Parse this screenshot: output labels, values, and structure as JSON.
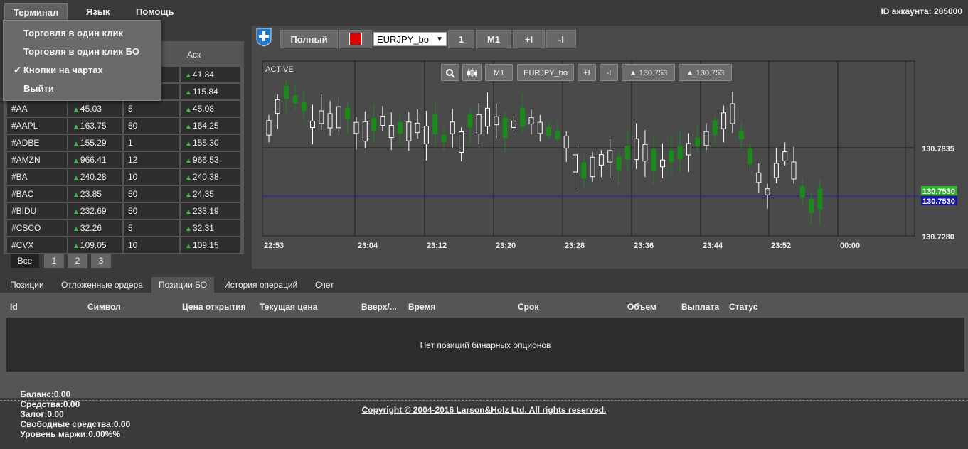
{
  "menu": {
    "terminal": "Терминал",
    "language": "Язык",
    "help": "Помощь"
  },
  "account": {
    "label": "ID аккаунта: 285000"
  },
  "dropdown": {
    "items": [
      "Торговля в один клик",
      "Торговля в один клик БО",
      "Кнопки на чартах",
      "Выйти"
    ],
    "checked_index": 2
  },
  "quotes": {
    "ask_header": "Аск",
    "partial_rows": [
      {
        "ask": "41.84"
      },
      {
        "ask": "115.84"
      }
    ],
    "rows": [
      {
        "symbol": "#AA",
        "bid": "45.03",
        "spread": "5",
        "ask": "45.08"
      },
      {
        "symbol": "#AAPL",
        "bid": "163.75",
        "spread": "50",
        "ask": "164.25"
      },
      {
        "symbol": "#ADBE",
        "bid": "155.29",
        "spread": "1",
        "ask": "155.30"
      },
      {
        "symbol": "#AMZN",
        "bid": "966.41",
        "spread": "12",
        "ask": "966.53"
      },
      {
        "symbol": "#BA",
        "bid": "240.28",
        "spread": "10",
        "ask": "240.38"
      },
      {
        "symbol": "#BAC",
        "bid": "23.85",
        "spread": "50",
        "ask": "24.35"
      },
      {
        "symbol": "#BIDU",
        "bid": "232.69",
        "spread": "50",
        "ask": "233.19"
      },
      {
        "symbol": "#CSCO",
        "bid": "32.26",
        "spread": "5",
        "ask": "32.31"
      },
      {
        "symbol": "#CVX",
        "bid": "109.05",
        "spread": "10",
        "ask": "109.15"
      }
    ],
    "pager": [
      "Все",
      "1",
      "2",
      "3"
    ]
  },
  "chart_toolbar": {
    "full": "Полный",
    "symbol": "EURJPY_bo",
    "qty": "1",
    "timeframe": "M1",
    "plus": "+I",
    "minus": "-I"
  },
  "chart": {
    "status": "ACTIVE",
    "inchart_buttons": [
      "M1",
      "EURJPY_bo",
      "+I",
      "-I",
      "▲ 130.753",
      "▲ 130.753"
    ],
    "time_labels": [
      "22:53",
      "23:04",
      "23:12",
      "23:20",
      "23:28",
      "23:36",
      "23:44",
      "23:52",
      "00:00"
    ],
    "price_labels": [
      "130.7835",
      "130.7280"
    ],
    "current_price_top": "130.7530",
    "current_price_bottom": "130.7530",
    "colors": {
      "bull": "#1a8a1a",
      "bear": "#ffffff",
      "current_line": "#1e1eb4",
      "price_green": "#2db52d",
      "price_blue": "#1a1aa0"
    }
  },
  "bottom_tabs": {
    "items": [
      "Позиции",
      "Отложенные ордера",
      "Позиции БО",
      "История операций",
      "Счет"
    ],
    "active_index": 2
  },
  "positions": {
    "columns": [
      "Id",
      "Символ",
      "Цена открытия",
      "Текущая цена",
      "Вверх/...",
      "Время",
      "Срок",
      "Объем",
      "Выплата",
      "Статус"
    ],
    "empty_text": "Нет позиций бинарных опционов"
  },
  "balance": {
    "items": [
      "Баланс:0.00",
      "Средства:0.00",
      "Залог:0.00",
      "Свободные средства:0.00",
      "Уровень маржи:0.00%%"
    ]
  },
  "footer": {
    "copyright": "Copyright © 2004-2016 Larson&Holz Ltd. All rights reserved."
  }
}
